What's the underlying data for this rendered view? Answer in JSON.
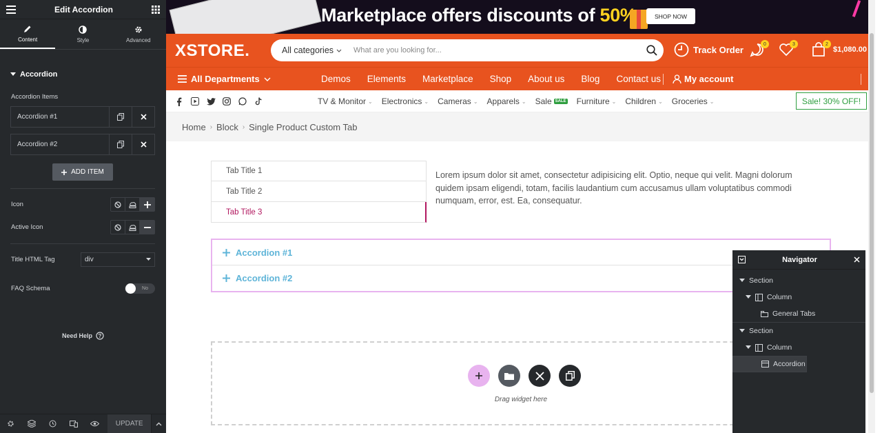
{
  "editor": {
    "title": "Edit Accordion",
    "tabs": [
      {
        "label": "Content",
        "icon": "pencil-icon"
      },
      {
        "label": "Style",
        "icon": "half-circle-icon"
      },
      {
        "label": "Advanced",
        "icon": "gear-icon"
      }
    ],
    "section_title": "Accordion",
    "items_label": "Accordion Items",
    "items": [
      "Accordion #1",
      "Accordion #2"
    ],
    "add_item": "ADD ITEM",
    "icon_label": "Icon",
    "active_icon_label": "Active Icon",
    "title_tag_label": "Title HTML Tag",
    "title_tag_value": "div",
    "faq_label": "FAQ Schema",
    "faq_value": "No",
    "need_help": "Need Help",
    "update": "UPDATE"
  },
  "promo": {
    "text": "Marketplace offers discounts of ",
    "percent": "50%",
    "button": "SHOP NOW"
  },
  "header": {
    "logo": "XSTORE.",
    "category": "All categories",
    "search_placeholder": "What are you looking for...",
    "track_order": "Track Order",
    "compare_count": "0",
    "wishlist_count": "3",
    "cart_count": "2",
    "cart_total": "$1,080.00"
  },
  "nav": {
    "all_departments": "All Departments",
    "links": [
      "Demos",
      "Elements",
      "Marketplace",
      "Shop",
      "About us",
      "Blog",
      "Contact us"
    ],
    "account": "My account"
  },
  "categories": {
    "links": [
      "TV & Monitor",
      "Electronics",
      "Cameras",
      "Apparels",
      "Sale",
      "Furniture",
      "Children",
      "Groceries"
    ],
    "sale_badge": "SALE",
    "sale_off": "Sale! 30% OFF!"
  },
  "breadcrumb": [
    "Home",
    "Block",
    "Single Product Custom Tab"
  ],
  "general_tabs": {
    "tabs": [
      "Tab Title 1",
      "Tab Title 2",
      "Tab Title 3"
    ],
    "active_index": 2,
    "content": "Lorem ipsum dolor sit amet, consectetur adipisicing elit. Optio, neque qui velit. Magni dolorum quidem ipsam eligendi, totam, facilis laudantium cum accusamus ullam voluptatibus commodi numquam, error, est. Ea, consequatur."
  },
  "accordion": {
    "items": [
      "Accordion #1",
      "Accordion #2"
    ]
  },
  "dropzone": {
    "hint": "Drag widget here"
  },
  "navigator": {
    "title": "Navigator",
    "tree": [
      {
        "label": "Section",
        "level": 0
      },
      {
        "label": "Column",
        "level": 1
      },
      {
        "label": "General Tabs",
        "level": 2
      },
      {
        "label": "Section",
        "level": 0
      },
      {
        "label": "Column",
        "level": 1
      },
      {
        "label": "Accordion",
        "level": 2
      }
    ]
  },
  "colors": {
    "brand_orange": "#e8531f",
    "editor_dark": "#26292c",
    "accent_pink": "#b1175f",
    "accordion_blue": "#5eb4d8",
    "sale_green": "#2e9e3f"
  }
}
